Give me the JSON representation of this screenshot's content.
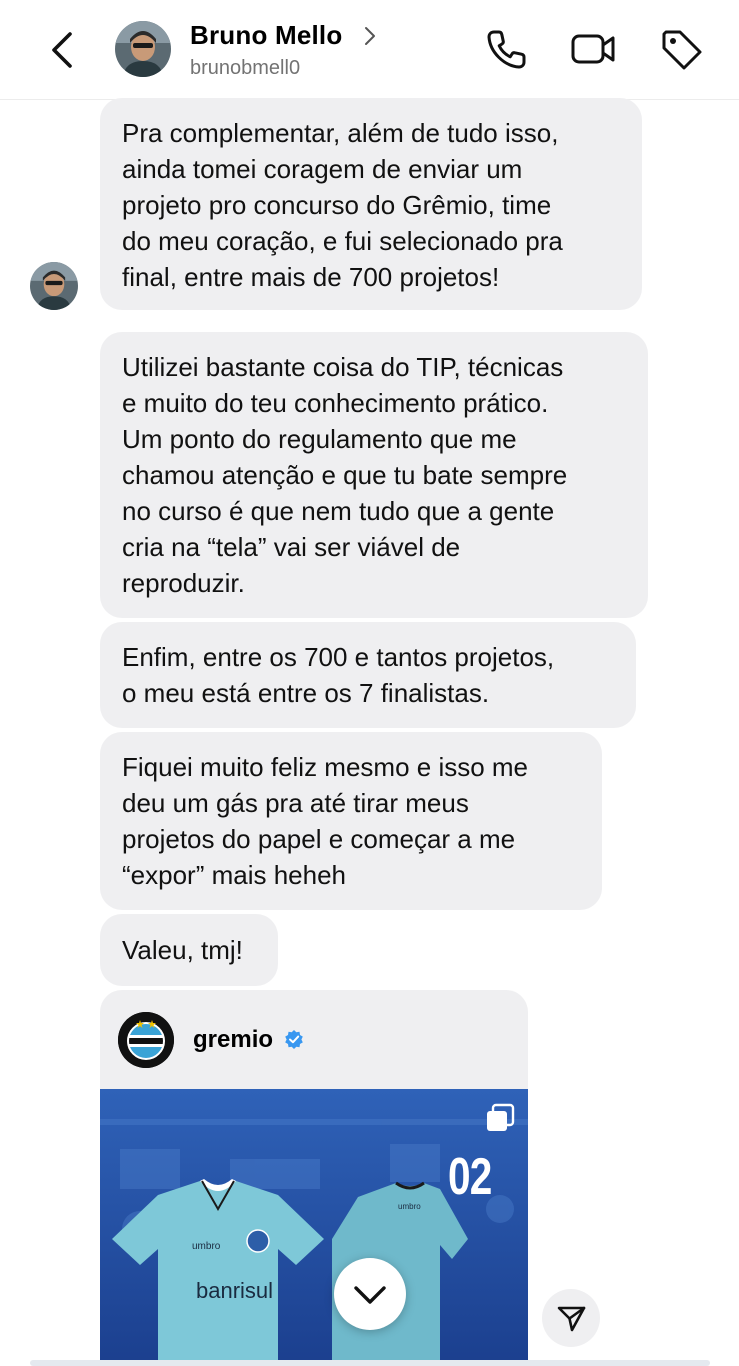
{
  "header": {
    "name": "Bruno Mello",
    "username": "brunobmell0",
    "back_icon": "chevron-left-icon",
    "profile_chevron_icon": "chevron-right-icon",
    "call_icon": "phone-icon",
    "video_icon": "video-camera-icon",
    "tag_icon": "tag-icon"
  },
  "messages": [
    {
      "text": "Pra complementar, além de tudo isso,\nainda tomei coragem de enviar um\nprojeto pro concurso do Grêmio, time\ndo meu coração, e fui selecionado pra\nfinal, entre mais de 700 projetos!"
    },
    {
      "text": "Utilizei bastante coisa do TIP, técnicas\ne muito do teu conhecimento prático.\nUm ponto do regulamento que me\nchamou atenção e que tu bate sempre\nno curso é que nem tudo que a gente\ncria na “tela” vai ser viável de\nreproduzir."
    },
    {
      "text": "Enfim, entre os 700 e tantos projetos,\no meu está entre os 7 finalistas."
    },
    {
      "text": "Fiquei muito feliz mesmo e isso me\ndeu um gás pra até tirar meus\nprojetos do papel e começar a me\n“expor” mais heheh"
    },
    {
      "text": "Valeu, tmj!"
    }
  ],
  "shared_post": {
    "username": "gremio",
    "verified_icon": "verified-badge-icon",
    "multi_icon": "carousel-icon",
    "number": "02",
    "sponsor": "banrisul"
  },
  "controls": {
    "scroll_down_icon": "chevron-down-icon",
    "send_icon": "send-icon"
  },
  "colors": {
    "bubble": "#efeff1",
    "verified": "#3897f0",
    "jersey": "#7ec8d8"
  }
}
